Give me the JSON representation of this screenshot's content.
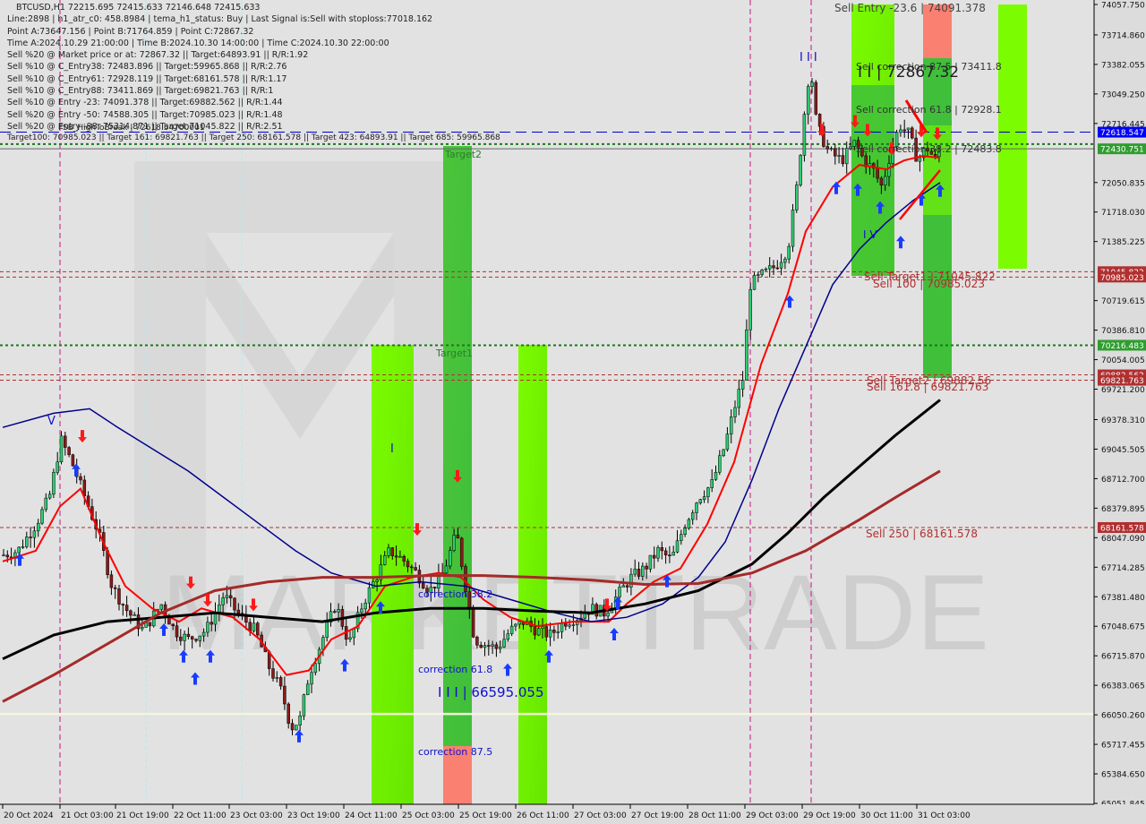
{
  "chart_data": {
    "type": "candlestick",
    "symbol": "BTCUSD",
    "timeframe": "H1",
    "ohlc_header": "BTCUSD,H1  72215.695 72415.633 72146.648 72415.633",
    "info_lines": [
      "Line:2898 | h1_atr_c0: 458.8984 | tema_h1_status: Buy | Last Signal is:Sell with stoploss:77018.162",
      "Point A:73647.156 | Point B:71764.859 | Point C:72867.32",
      "Time A:2024.10.29 21:00:00 | Time B:2024.10.30 14:00:00 | Time C:2024.10.30 22:00:00",
      "Sell %20 @ Market price or at: 72867.32 || Target:64893.91 || R/R:1.92",
      "Sell %10 @ C_Entry38: 72483.896 || Target:59965.868 || R/R:2.76",
      "Sell %10 @ C_Entry61: 72928.119 || Target:68161.578 || R/R:1.17",
      "Sell %10 @ C_Entry88: 73411.869 || Target:69821.763 || R/R:1",
      "Sell %10 @ Entry -23: 74091.378 || Target:69882.562 || R/R:1.44",
      "Sell %20 @ Entry -50: 74588.305 || Target:70985.023 || R/R:1.48",
      "Sell %20 @ Entry -88: 75314.871 || Target:71045.822 || R/R:2.51",
      "Target100: 70985.023 || Target 161: 69821.763 || Target 250: 68161.578 || Target 423: 64893.91 || Target 685: 59965.868"
    ],
    "overlap_text": "FSB_HighToBreak | 72618.54700001",
    "y_axis": {
      "min": 65051.845,
      "max": 74057.75,
      "ticks": [
        "74057.750",
        "73714.860",
        "73382.055",
        "73049.250",
        "72716.445",
        "72050.835",
        "71718.030",
        "71385.225",
        "70719.615",
        "70386.810",
        "70054.005",
        "69721.200",
        "69378.310",
        "69045.505",
        "68712.700",
        "68379.895",
        "68047.090",
        "67714.285",
        "67381.480",
        "67048.675",
        "66715.870",
        "66383.065",
        "66050.260",
        "65717.455",
        "65384.650",
        "65051.845"
      ]
    },
    "x_axis": {
      "ticks": [
        "20 Oct 2024",
        "21 Oct 03:00",
        "21 Oct 19:00",
        "22 Oct 11:00",
        "23 Oct 03:00",
        "23 Oct 19:00",
        "24 Oct 11:00",
        "25 Oct 03:00",
        "25 Oct 19:00",
        "26 Oct 11:00",
        "27 Oct 03:00",
        "27 Oct 19:00",
        "28 Oct 11:00",
        "29 Oct 03:00",
        "29 Oct 19:00",
        "30 Oct 11:00",
        "31 Oct 03:00"
      ]
    },
    "price_labels": [
      {
        "value": 72618.547,
        "text": "72618.547",
        "color": "#0000ff"
      },
      {
        "value": 72430.751,
        "text": "72430.751",
        "color": "#2e9e2e"
      },
      {
        "value": 71045.822,
        "text": "71045.822",
        "color": "#b03030"
      },
      {
        "value": 70985.023,
        "text": "70985.023",
        "color": "#b03030"
      },
      {
        "value": 70216.483,
        "text": "70216.483",
        "color": "#2e9e2e"
      },
      {
        "value": 69882.562,
        "text": "69882.562",
        "color": "#b03030"
      },
      {
        "value": 69821.763,
        "text": "69821.763",
        "color": "#b03030"
      },
      {
        "value": 68161.578,
        "text": "68161.578",
        "color": "#b03030"
      }
    ],
    "horizontal_lines": [
      {
        "value": 72618.547,
        "color": "#0000cc",
        "style": "dashed"
      },
      {
        "value": 72483.8,
        "color": "#1a7a1a",
        "style": "dotted"
      },
      {
        "value": 72430.751,
        "color": "#666666",
        "style": "solid"
      },
      {
        "value": 71045.822,
        "color": "#b03030",
        "style": "dashed"
      },
      {
        "value": 70985.023,
        "color": "#b03030",
        "style": "dashed"
      },
      {
        "value": 70216.483,
        "color": "#1a7a1a",
        "style": "dotted"
      },
      {
        "value": 69882.562,
        "color": "#b03030",
        "style": "dashed"
      },
      {
        "value": 69821.763,
        "color": "#b03030",
        "style": "dashed"
      },
      {
        "value": 68161.578,
        "color": "#b03030",
        "style": "dashed"
      },
      {
        "value": 66060,
        "color": "#f5f5dc",
        "style": "solid"
      }
    ],
    "annotations": [
      {
        "text": "Sell Entry -23.6 | 74091.378",
        "color": "#444444"
      },
      {
        "text": "Sell correction 87.5 | 73411.8",
        "color": "#333333"
      },
      {
        "text": "I I | 72867.32",
        "color": "#222222"
      },
      {
        "text": "Sell correction 61.8 | 72928.1",
        "color": "#333333"
      },
      {
        "text": "Sell correction 38.2 | 72483.8",
        "color": "#333333"
      },
      {
        "text": "Sell Target1 | 71045.822",
        "color": "#b03030"
      },
      {
        "text": "Sell 100 | 70985.023",
        "color": "#b03030"
      },
      {
        "text": "Sell Target2 | 69882.56",
        "color": "#b03030"
      },
      {
        "text": "Sell 161.8 | 69821.763",
        "color": "#b03030"
      },
      {
        "text": "Sell 250 | 68161.578",
        "color": "#b03030"
      },
      {
        "text": "Target2",
        "color": "#2e7d2e"
      },
      {
        "text": "Target1",
        "color": "#2e7d2e"
      },
      {
        "text": "correction 38.2",
        "color": "#1010cc"
      },
      {
        "text": "correction 61.8",
        "color": "#1010cc"
      },
      {
        "text": "I I I | 66595.055",
        "color": "#1010cc"
      },
      {
        "text": "correction 87.5",
        "color": "#1010cc"
      },
      {
        "text": "I I I",
        "color": "#1010cc"
      },
      {
        "text": "I V",
        "color": "#1010cc"
      },
      {
        "text": "V",
        "color": "#1010cc"
      },
      {
        "text": "I",
        "color": "#1010cc"
      }
    ],
    "watermark": "MARKETTRADE",
    "series": [
      {
        "name": "MA fast (red)",
        "color": "#ff0000"
      },
      {
        "name": "MA mid (navy)",
        "color": "#00008b"
      },
      {
        "name": "MA slow (black)",
        "color": "#000000"
      },
      {
        "name": "MA slow2 (brown)",
        "color": "#a52a2a"
      }
    ],
    "grid": false
  }
}
